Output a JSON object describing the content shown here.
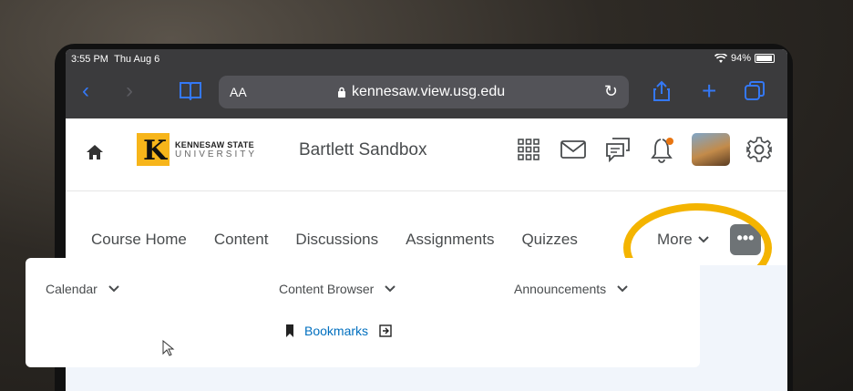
{
  "status": {
    "time": "3:55 PM",
    "date": "Thu Aug 6",
    "battery": "94%"
  },
  "browser": {
    "text_size": "AA",
    "url": "kennesaw.view.usg.edu"
  },
  "header": {
    "logo_line1": "KENNESAW STATE",
    "logo_line2": "UNIVERSITY",
    "course_title": "Bartlett Sandbox"
  },
  "nav": {
    "items": [
      "Course Home",
      "Content",
      "Discussions",
      "Assignments",
      "Quizzes"
    ],
    "more_label": "More",
    "overflow_label": "•••"
  },
  "widgets": {
    "calendar": "Calendar",
    "content_browser": "Content Browser",
    "announcements": "Announcements",
    "bookmarks": "Bookmarks"
  },
  "colors": {
    "highlight": "#f4b400",
    "link": "#006fbf",
    "safari_accent": "#3478f6"
  }
}
